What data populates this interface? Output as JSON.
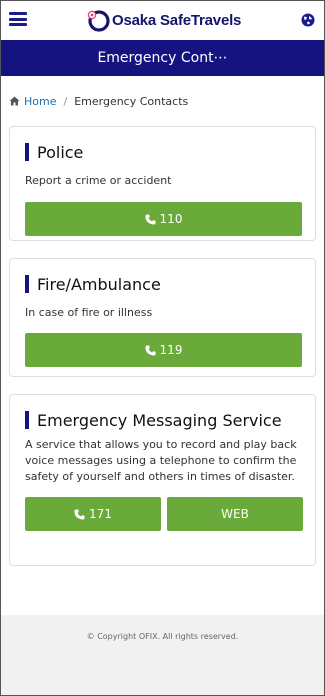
{
  "header": {
    "brand_text": "Osaka SafeTravels",
    "menu_icon": "hamburger-menu-icon",
    "globe_icon": "globe-icon"
  },
  "titlebar": {
    "title": "Emergency Cont⋯"
  },
  "breadcrumb": {
    "home": "Home",
    "separator": "/",
    "current": "Emergency Contacts"
  },
  "cards": [
    {
      "title": "Police",
      "description": "Report a crime or accident",
      "button_label": "110"
    },
    {
      "title": "Fire/Ambulance",
      "description": "In case of fire or illness",
      "button_label": "119"
    },
    {
      "title": "Emergency Messaging Service",
      "description": "A service that allows you to record and play back voice messages using a telephone to confirm the safety of yourself and others in times of disaster.",
      "button_label": "171",
      "web_label": "WEB"
    }
  ],
  "footer": {
    "copyright": "© Copyright OFIX. All rights reserved."
  },
  "colors": {
    "navy": "#14137f",
    "green": "#6aaa3a",
    "link": "#1f6fb5"
  }
}
